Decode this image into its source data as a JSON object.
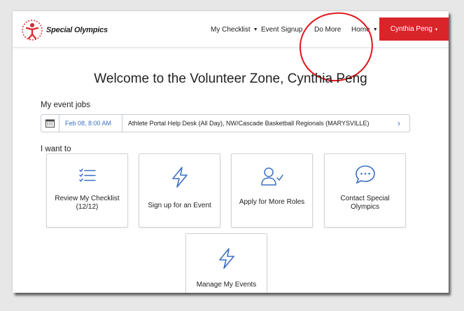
{
  "brand": {
    "name": "Special Olympics"
  },
  "nav": {
    "items": [
      {
        "label": "My Checklist",
        "has_caret": true
      },
      {
        "label": "Event Signup",
        "has_caret": false
      },
      {
        "label": "Do More",
        "has_caret": false
      },
      {
        "label": "Home",
        "has_caret": true
      }
    ],
    "user": "Cynthia Peng",
    "user_caret": "▾"
  },
  "welcome": "Welcome to the Volunteer Zone, Cynthia Peng",
  "event_jobs": {
    "label": "My event jobs",
    "items": [
      {
        "date": "Feb 08, 8:00 AM",
        "title": "Athlete Portal Help Desk (All Day), NW/Cascade Basketball Regionals (MARYSVILLE)",
        "arrow": "›"
      }
    ]
  },
  "i_want_to": {
    "label": "I want to",
    "cards": [
      {
        "label": "Review My Checklist (12/12)",
        "icon": "checklist-icon"
      },
      {
        "label": "Sign up for an Event",
        "icon": "lightning-icon"
      },
      {
        "label": "Apply for More Roles",
        "icon": "user-check-icon"
      },
      {
        "label": "Contact Special Olympics",
        "icon": "chat-bubble-icon"
      },
      {
        "label": "Manage My Events",
        "icon": "lightning-icon"
      }
    ]
  },
  "colors": {
    "accent_red": "#d9252a",
    "icon_blue": "#3b6fc4",
    "annotation_red": "#e0151b"
  }
}
